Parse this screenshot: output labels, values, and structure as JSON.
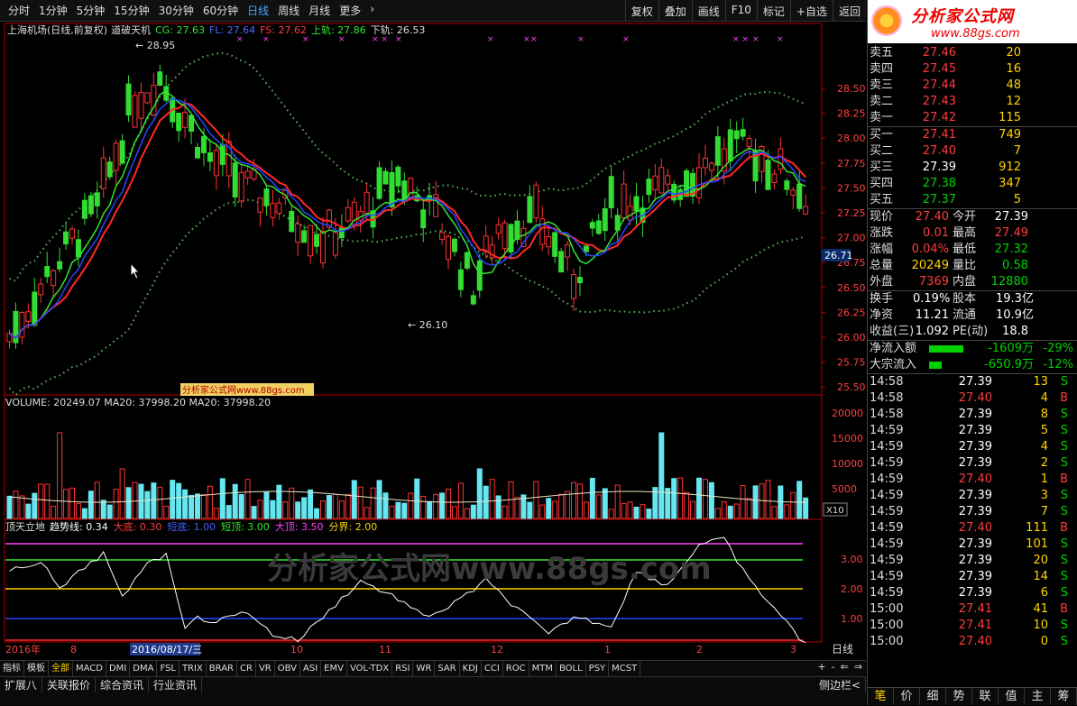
{
  "toolbar": {
    "periods": [
      "分时",
      "1分钟",
      "5分钟",
      "15分钟",
      "30分钟",
      "60分钟",
      "日线",
      "周线",
      "月线",
      "更多",
      "›"
    ],
    "active_period": "日线",
    "tools": [
      "复权",
      "叠加",
      "画线",
      "F10",
      "标记",
      "+自选",
      "返回"
    ]
  },
  "main_chart": {
    "title": "上海机场(日线,前复权)",
    "indicator_name": "道破天机",
    "cg_label": "CG: 27.63",
    "fl_label": "FL: 27.64",
    "fs_label": "FS: 27.62",
    "upper_label": "上轨: 27.86",
    "lower_label": "下轨: 26.53",
    "high_mark": "28.95",
    "low_mark": "26.10",
    "cursor_price": "26.71",
    "price_ticks": [
      "28.50",
      "28.25",
      "28.00",
      "27.75",
      "27.50",
      "27.25",
      "27.00",
      "26.75",
      "26.50",
      "26.25",
      "26.00",
      "25.75",
      "25.50"
    ],
    "watermark_small": "分析家公式网www.88gs.com",
    "colors": {
      "up": "#ff3232",
      "down": "#32dc32",
      "ma_red": "#ff2828",
      "ma_green": "#32e632",
      "ma_blue": "#2846ff",
      "band": "#5ab45a"
    }
  },
  "volume": {
    "label": "VOLUME: 20249.07  MA20: 37998.20  MA20: 37998.20",
    "ticks": [
      "20000",
      "15000",
      "10000",
      "5000"
    ],
    "unit": "X10"
  },
  "indicator": {
    "name": "顶天立地",
    "trend": "趋势线: 0.34",
    "bottom": "大底: 0.30",
    "short_bottom": "短底: 1.00",
    "short_top": "短顶: 3.00",
    "top": "大顶: 3.50",
    "boundary": "分界: 2.00",
    "ticks": [
      "3.00",
      "2.00",
      "1.00"
    ],
    "watermark": "分析家公式网www.88gs.com"
  },
  "date_axis": {
    "labels": [
      "2016年",
      "8",
      "9",
      "10",
      "11",
      "12",
      "1",
      "2",
      "3"
    ],
    "cursor_date": "2016/08/17/三",
    "period_label": "日线"
  },
  "bottom": {
    "indicators": [
      "指标",
      "模板",
      "全部",
      "MACD",
      "DMI",
      "DMA",
      "FSL",
      "TRIX",
      "BRAR",
      "CR",
      "VR",
      "OBV",
      "ASI",
      "EMV",
      "VOL-TDX",
      "RSI",
      "WR",
      "SAR",
      "KDJ",
      "CCI",
      "ROC",
      "MTM",
      "BOLL",
      "PSY",
      "MCST"
    ],
    "active_indicator": "全部",
    "tabs": [
      "扩展八",
      "关联报价",
      "综合资讯",
      "行业资讯"
    ],
    "right_btns": [
      "+",
      "-",
      "⇐",
      "⇒"
    ],
    "side_label": "侧边栏<"
  },
  "logo": {
    "title": "分析家公式网",
    "url": "www.88gs.com"
  },
  "order_book": {
    "weibi": "委比",
    "sells": [
      {
        "label": "卖五",
        "price": "27.46",
        "vol": "20"
      },
      {
        "label": "卖四",
        "price": "27.45",
        "vol": "16"
      },
      {
        "label": "卖三",
        "price": "27.44",
        "vol": "48"
      },
      {
        "label": "卖二",
        "price": "27.43",
        "vol": "12"
      },
      {
        "label": "卖一",
        "price": "27.42",
        "vol": "115"
      }
    ],
    "buys": [
      {
        "label": "买一",
        "price": "27.41",
        "vol": "749"
      },
      {
        "label": "买二",
        "price": "27.40",
        "vol": "7"
      },
      {
        "label": "买三",
        "price": "27.39",
        "vol": "912"
      },
      {
        "label": "买四",
        "price": "27.38",
        "vol": "347"
      },
      {
        "label": "买五",
        "price": "27.37",
        "vol": "5"
      }
    ]
  },
  "quote": [
    {
      "a": "现价",
      "b": "27.40",
      "bc": "red",
      "c": "今开",
      "d": "27.39",
      "dc": "white"
    },
    {
      "a": "涨跌",
      "b": "0.01",
      "bc": "red",
      "c": "最高",
      "d": "27.49",
      "dc": "red"
    },
    {
      "a": "涨幅",
      "b": "0.04%",
      "bc": "red",
      "c": "最低",
      "d": "27.32",
      "dc": "green"
    },
    {
      "a": "总量",
      "b": "20249",
      "bc": "yellow",
      "c": "量比",
      "d": "0.58",
      "dc": "green"
    },
    {
      "a": "外盘",
      "b": "7369",
      "bc": "red",
      "c": "内盘",
      "d": "12880",
      "dc": "green"
    }
  ],
  "stats": [
    {
      "a": "换手",
      "b": "0.19%",
      "c": "股本",
      "d": "19.3亿"
    },
    {
      "a": "净资",
      "b": "11.21",
      "c": "流通",
      "d": "10.9亿"
    },
    {
      "a": "收益(三)",
      "b": "1.092",
      "c": "PE(动)",
      "d": "18.8"
    }
  ],
  "flows": [
    {
      "label": "净流入额",
      "value": "-1609万",
      "pct": "-29%",
      "bar": 0.8
    },
    {
      "label": "大宗流入",
      "value": "-650.9万",
      "pct": "-12%",
      "bar": 0.3
    }
  ],
  "ticks": [
    {
      "t": "14:58",
      "p": "27.39",
      "pc": "white",
      "v": "13",
      "s": "S"
    },
    {
      "t": "14:58",
      "p": "27.40",
      "pc": "red",
      "v": "4",
      "s": "B"
    },
    {
      "t": "14:58",
      "p": "27.39",
      "pc": "white",
      "v": "8",
      "s": "S"
    },
    {
      "t": "14:59",
      "p": "27.39",
      "pc": "white",
      "v": "5",
      "s": "S"
    },
    {
      "t": "14:59",
      "p": "27.39",
      "pc": "white",
      "v": "4",
      "s": "S"
    },
    {
      "t": "14:59",
      "p": "27.39",
      "pc": "white",
      "v": "2",
      "s": "S"
    },
    {
      "t": "14:59",
      "p": "27.40",
      "pc": "red",
      "v": "1",
      "s": "B"
    },
    {
      "t": "14:59",
      "p": "27.39",
      "pc": "white",
      "v": "3",
      "s": "S"
    },
    {
      "t": "14:59",
      "p": "27.39",
      "pc": "white",
      "v": "7",
      "s": "S"
    },
    {
      "t": "14:59",
      "p": "27.40",
      "pc": "red",
      "v": "111",
      "s": "B"
    },
    {
      "t": "14:59",
      "p": "27.39",
      "pc": "white",
      "v": "101",
      "s": "S"
    },
    {
      "t": "14:59",
      "p": "27.39",
      "pc": "white",
      "v": "20",
      "s": "S"
    },
    {
      "t": "14:59",
      "p": "27.39",
      "pc": "white",
      "v": "14",
      "s": "S"
    },
    {
      "t": "14:59",
      "p": "27.39",
      "pc": "white",
      "v": "6",
      "s": "S"
    },
    {
      "t": "15:00",
      "p": "27.41",
      "pc": "red",
      "v": "41",
      "s": "B"
    },
    {
      "t": "15:00",
      "p": "27.41",
      "pc": "red",
      "v": "10",
      "s": "S"
    },
    {
      "t": "15:00",
      "p": "27.40",
      "pc": "red",
      "v": "0",
      "s": "S"
    }
  ],
  "right_tabs": [
    "笔",
    "价",
    "细",
    "势",
    "联",
    "值",
    "主",
    "筹"
  ]
}
